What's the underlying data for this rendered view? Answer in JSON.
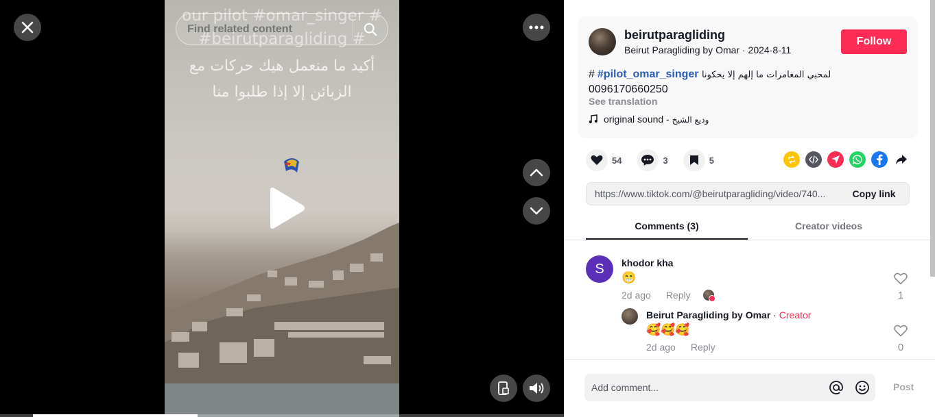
{
  "video": {
    "overlay_hashtags": "our pilot #omar_singer # #beirutparagliding #",
    "overlay_arabic": "أكيد ما منعمل هيك حركات مع الزبائن إلا إذا طلبوا منا",
    "search_placeholder": "Find related content",
    "progress": 0.35,
    "icons": {
      "close": "close-icon",
      "more": "more-icon",
      "search": "search-icon",
      "play": "play-icon",
      "up": "chevron-up-icon",
      "down": "chevron-down-icon",
      "pip": "picture-in-picture-icon",
      "volume": "volume-icon"
    }
  },
  "author": {
    "username": "beirutparagliding",
    "display_name": "Beirut Paragliding by Omar",
    "separator": " · ",
    "date": "2024-8-11",
    "follow_label": "Follow"
  },
  "caption": {
    "hash": "#",
    "tag": "#pilot_omar_singer",
    "arabic": "لمحبي المغامرات ما إلهم إلا يحكونا",
    "phone": "0096170660250",
    "see_translation": "See translation"
  },
  "sound": {
    "label": "original sound - ",
    "artist": "وديع الشيخ"
  },
  "stats": {
    "likes": "54",
    "comments": "3",
    "saves": "5"
  },
  "share_icons": [
    "repost-icon",
    "embed-icon",
    "send-icon",
    "whatsapp-icon",
    "facebook-icon",
    "share-arrow-icon"
  ],
  "colors": {
    "accent": "#fe2c55",
    "tag": "#2b5db9",
    "repost": "#ffc300",
    "embed": "#545661",
    "send": "#fe2c55",
    "whatsapp": "#25d366",
    "facebook": "#1877f2"
  },
  "link": {
    "url": "https://www.tiktok.com/@beirutparagliding/video/740...",
    "copy_label": "Copy link"
  },
  "tabs": [
    {
      "label": "Comments (3)",
      "active": true
    },
    {
      "label": "Creator videos",
      "active": false
    }
  ],
  "comments": [
    {
      "avatar_letter": "S",
      "name": "khodor kha",
      "text": "😁",
      "time": "2d ago",
      "reply_label": "Reply",
      "likes": "1"
    }
  ],
  "reply": {
    "name": "Beirut Paragliding by Omar",
    "sep": " · ",
    "badge": "Creator",
    "text": "🥰🥰🥰",
    "time": "2d ago",
    "reply_label": "Reply",
    "likes": "0"
  },
  "compose": {
    "placeholder": "Add comment...",
    "post_label": "Post"
  }
}
